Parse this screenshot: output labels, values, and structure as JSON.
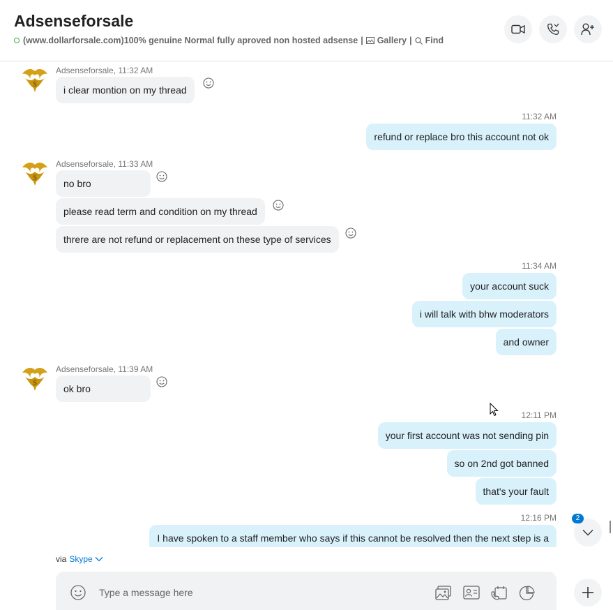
{
  "header": {
    "title": "Adsenseforsale",
    "mood": "(www.dollarforsale.com)100% genuine Normal fully aproved non hosted adsense",
    "separator": "|",
    "gallery_label": "Gallery",
    "find_label": "Find",
    "buttons": [
      "video-call",
      "audio-call",
      "add-people"
    ]
  },
  "messages": [
    {
      "dir": "in",
      "sender_meta": "Adsenseforsale, 11:32 AM",
      "text": "i clear montion on my thread"
    },
    {
      "dir": "out",
      "time": "11:32 AM",
      "text": "refund or replace bro this account not ok"
    },
    {
      "dir": "in",
      "sender_meta": "Adsenseforsale, 11:33 AM",
      "text": "no bro"
    },
    {
      "dir": "in",
      "text": "please read term and condition on my thread"
    },
    {
      "dir": "in",
      "text": "threre are not refund or replacement on these type of services"
    },
    {
      "dir": "out",
      "time": "11:34 AM",
      "text": "your account suck"
    },
    {
      "dir": "out",
      "text": "i will talk with bhw moderators"
    },
    {
      "dir": "out",
      "text": "and owner"
    },
    {
      "dir": "in",
      "sender_meta": "Adsenseforsale, 11:39 AM",
      "text": "ok bro"
    },
    {
      "dir": "out",
      "time": "12:11 PM",
      "text": "your first account was not sending pin"
    },
    {
      "dir": "out",
      "text": "so on 2nd got banned"
    },
    {
      "dir": "out",
      "text": "that's your fault"
    },
    {
      "dir": "out",
      "time": "12:16 PM",
      "text": "I have spoken to a staff member who says if this cannot be resolved then the next step is a"
    }
  ],
  "unread_badge": "2",
  "via": {
    "prefix": "via",
    "app": "Skype"
  },
  "composer": {
    "placeholder": "Type a message here"
  },
  "colors": {
    "accent": "#0078d4",
    "outgoing_bubble": "#d8f1fb",
    "incoming_bubble": "#f1f2f4",
    "online": "#37b34a"
  }
}
